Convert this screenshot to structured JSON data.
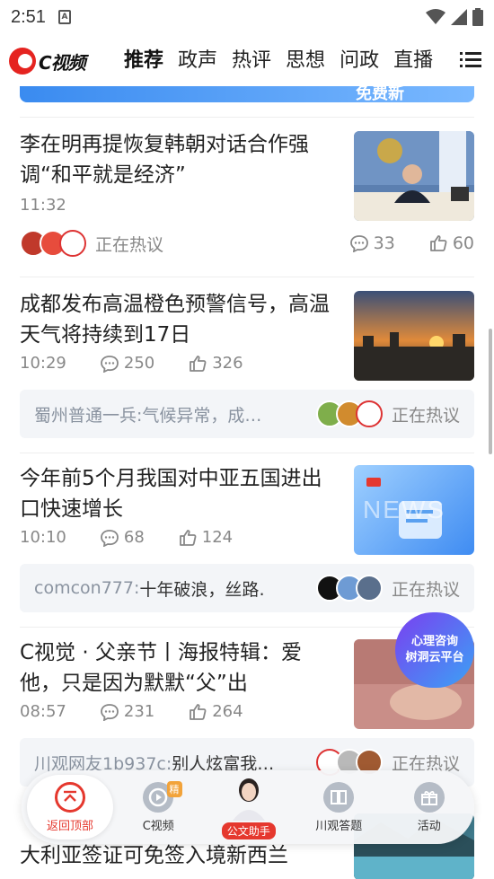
{
  "status_bar": {
    "time": "2:51",
    "sim_label": "A"
  },
  "top_nav": {
    "logo_text": "C视频",
    "tabs": [
      "推荐",
      "政声",
      "热评",
      "思想",
      "问政",
      "直播"
    ]
  },
  "banner": {
    "text": "免费新"
  },
  "articles": [
    {
      "title": "李在明再提恢复韩朝对话合作强调“和平就是经济”",
      "time": "11:32",
      "hot_label": "正在热议",
      "comments": "33",
      "likes": "60",
      "thumb_icon": "press-conference-photo"
    },
    {
      "title": "成都发布高温橙色预警信号，高温天气将持续到17日",
      "time": "10:29",
      "comments": "250",
      "likes": "326",
      "thumb_icon": "sunset-city-photo",
      "comment_user": "蜀州普通一兵:",
      "comment_text": "气候异常，成…",
      "hot_label": "正在热议"
    },
    {
      "title": "今年前5个月我国对中亚五国进出口快速增长",
      "time": "10:10",
      "comments": "68",
      "likes": "124",
      "thumb_icon": "news-graphic",
      "thumb_text": "NEWS",
      "comment_user": "comcon777:",
      "comment_text": "十年破浪，丝路…",
      "hot_label": "正在热议"
    },
    {
      "title": "C视觉 · 父亲节丨海报特辑：爱他，只是因为默默“父”出",
      "time": "08:57",
      "comments": "231",
      "likes": "264",
      "thumb_icon": "poster-image",
      "comment_user": "川观网友1b937c:",
      "comment_text": "别人炫富我…",
      "hot_label": "正在热议"
    },
    {
      "title": "大利亚签证可免签入境新西兰",
      "thumb_icon": "lake-photo"
    }
  ],
  "floating_ad": {
    "line1": "心理咨询",
    "line2": "树洞云平台"
  },
  "bottom_nav": {
    "items": [
      {
        "label": "返回顶部",
        "icon": "back-to-top-icon"
      },
      {
        "label": "C视频",
        "icon": "c-video-icon",
        "badge": "精"
      },
      {
        "label": "公文助手",
        "icon": "assistant-avatar"
      },
      {
        "label": "川观答题",
        "icon": "book-icon"
      },
      {
        "label": "活动",
        "icon": "gift-icon"
      }
    ]
  },
  "colors": {
    "accent": "#e5382e",
    "meta": "#888888",
    "comment_bg": "#f3f5f8"
  }
}
